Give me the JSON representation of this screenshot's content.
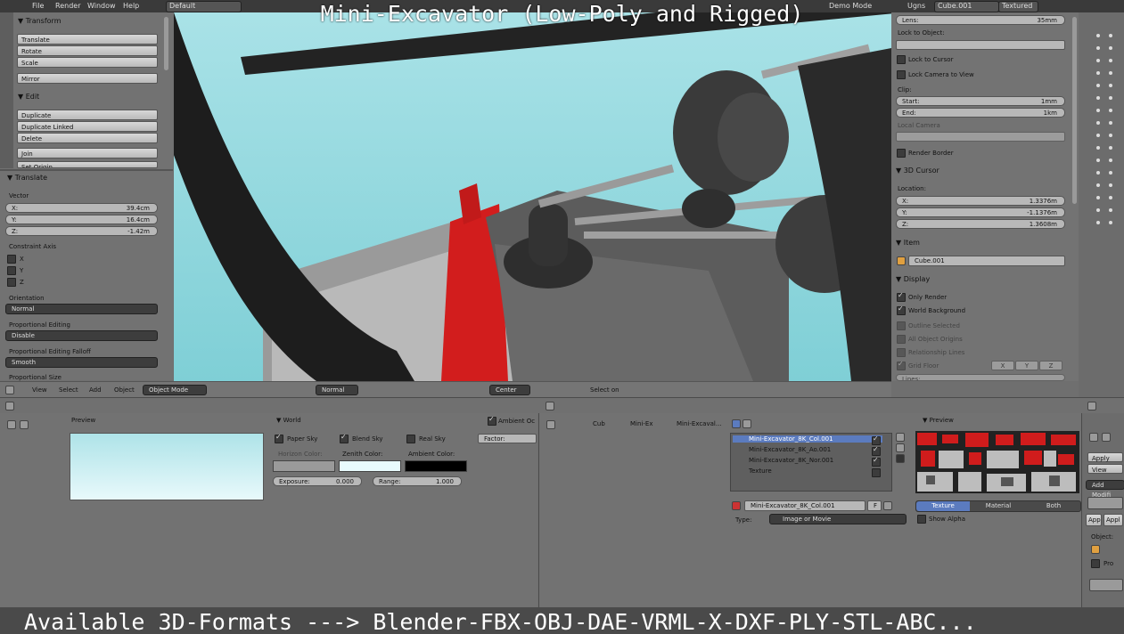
{
  "overlay": {
    "title": "Mini-Excavator (Low-Poly and Rigged)",
    "formats": "Available 3D-Formats ---> Blender-FBX-OBJ-DAE-VRML-X-DXF-PLY-STL-ABC..."
  },
  "topbar": {
    "file": "File",
    "render": "Render",
    "window": "Window",
    "help": "Help",
    "layout": "Default",
    "demo_mode": "Demo Mode",
    "ugns": "Ugns",
    "object": "Cube.001",
    "shading": "Textured"
  },
  "toolshelf": {
    "transform_header": "Transform",
    "translate": "Translate",
    "rotate": "Rotate",
    "scale": "Scale",
    "mirror": "Mirror",
    "edit_header": "Edit",
    "duplicate": "Duplicate",
    "duplicate_linked": "Duplicate Linked",
    "delete": "Delete",
    "join": "Join",
    "set_origin": "Set Origin"
  },
  "operator": {
    "header": "Translate",
    "vector_label": "Vector",
    "x_label": "X:",
    "x_value": "39.4cm",
    "y_label": "Y:",
    "y_value": "16.4cm",
    "z_label": "Z:",
    "z_value": "-1.42m",
    "constraint_label": "Constraint Axis",
    "cx": "X",
    "cy": "Y",
    "cz": "Z",
    "orientation_label": "Orientation",
    "orientation_value": "Normal",
    "prop_edit_label": "Proportional Editing",
    "prop_edit_value": "Disable",
    "prop_falloff_label": "Proportional Editing Falloff",
    "prop_falloff_value": "Smooth",
    "prop_size_label": "Proportional Size"
  },
  "viewport_header": {
    "view": "View",
    "select": "Select",
    "add": "Add",
    "object": "Object",
    "mode": "Object Mode",
    "orientation": "Normal",
    "pivot": "Center",
    "status": "Select on"
  },
  "npanel": {
    "lens_label": "Lens:",
    "lens_value": "35mm",
    "lock_to_object": "Lock to Object:",
    "lock_to_cursor": "Lock to Cursor",
    "lock_camera": "Lock Camera to View",
    "clip_label": "Clip:",
    "start_label": "Start:",
    "start_value": "1mm",
    "end_label": "End:",
    "end_value": "1km",
    "local_camera": "Local Camera",
    "render_border": "Render Border",
    "cursor_header": "3D Cursor",
    "location_label": "Location:",
    "cx_label": "X:",
    "cx_value": "1.3376m",
    "cy_label": "Y:",
    "cy_value": "-1.1376m",
    "cz_label": "Z:",
    "cz_value": "1.3608m",
    "item_header": "Item",
    "item_name": "Cube.001",
    "display_header": "Display",
    "only_render": "Only Render",
    "world_background": "World Background",
    "outline_selected": "Outline Selected",
    "all_object_origins": "All Object Origins",
    "relationship_lines": "Relationship Lines",
    "grid_floor": "Grid Floor",
    "gx": "X",
    "gy": "Y",
    "gz": "Z",
    "lines": "Lines:"
  },
  "world": {
    "preview_label": "Preview",
    "world_label": "World",
    "paper_sky": "Paper Sky",
    "blend_sky": "Blend Sky",
    "real_sky": "Real Sky",
    "horizon_label": "Horizon Color:",
    "zenith_label": "Zenith Color:",
    "ambient_label": "Ambient Color:",
    "exposure_label": "Exposure:",
    "exposure_value": "0.000",
    "range_label": "Range:",
    "range_value": "1.000",
    "ao_label": "Ambient Oc",
    "factor_label": "Factor:",
    "horizon_color": "#9a9a9a",
    "zenith_color": "#e9fbfd",
    "ambient_color": "#000000"
  },
  "texture": {
    "crumb1": "Cub",
    "crumb2": "Mini-Ex",
    "crumb3": "Mini-Excaval...",
    "slots": [
      {
        "name": "Mini-Excavator_8K_Col.001"
      },
      {
        "name": "Mini-Excavator_8K_Ao.001"
      },
      {
        "name": "Mini-Excavator_8K_Nor.001"
      },
      {
        "name": "Texture"
      }
    ],
    "tex_name": "Mini-Excavator_8K_Col.001",
    "f_label": "F",
    "type_label": "Type:",
    "type_value": "Image or Movie",
    "preview_label": "Preview",
    "tab_texture": "Texture",
    "tab_material": "Material",
    "tab_both": "Both",
    "show_alpha": "Show Alpha"
  },
  "modifiers": {
    "apply": "Apply",
    "view": "View",
    "add_modifier": "Add Modifi",
    "app1": "App",
    "app2": "Appl",
    "object_label": "Object:",
    "pro": "Pro"
  }
}
